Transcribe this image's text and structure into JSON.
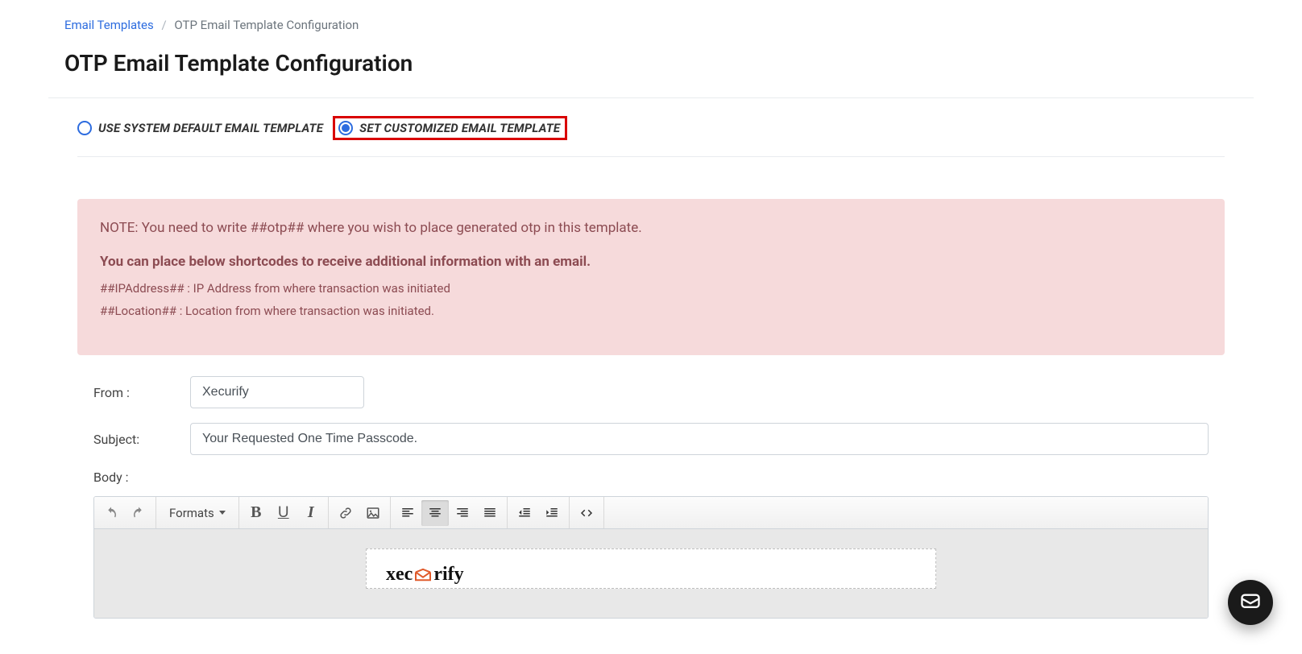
{
  "breadcrumb": {
    "parent": "Email Templates",
    "current": "OTP Email Template Configuration"
  },
  "page_title": "OTP Email Template Configuration",
  "radios": {
    "default_label": "USE SYSTEM DEFAULT EMAIL TEMPLATE",
    "custom_label": "SET CUSTOMIZED EMAIL TEMPLATE"
  },
  "note": {
    "line1": "NOTE: You need to write ##otp## where you wish to place generated otp in this template.",
    "heading": "You can place below shortcodes to receive additional information with an email.",
    "sc1": "##IPAddress## : IP Address from where transaction was initiated",
    "sc2": "##Location## : Location from where transaction was initiated."
  },
  "form": {
    "from_label": "From :",
    "from_value": "Xecurify",
    "subject_label": "Subject:",
    "subject_value": "Your Requested One Time Passcode.",
    "body_label": "Body :"
  },
  "toolbar": {
    "formats": "Formats"
  },
  "brand": {
    "part1": "xec",
    "part2": "rify"
  }
}
